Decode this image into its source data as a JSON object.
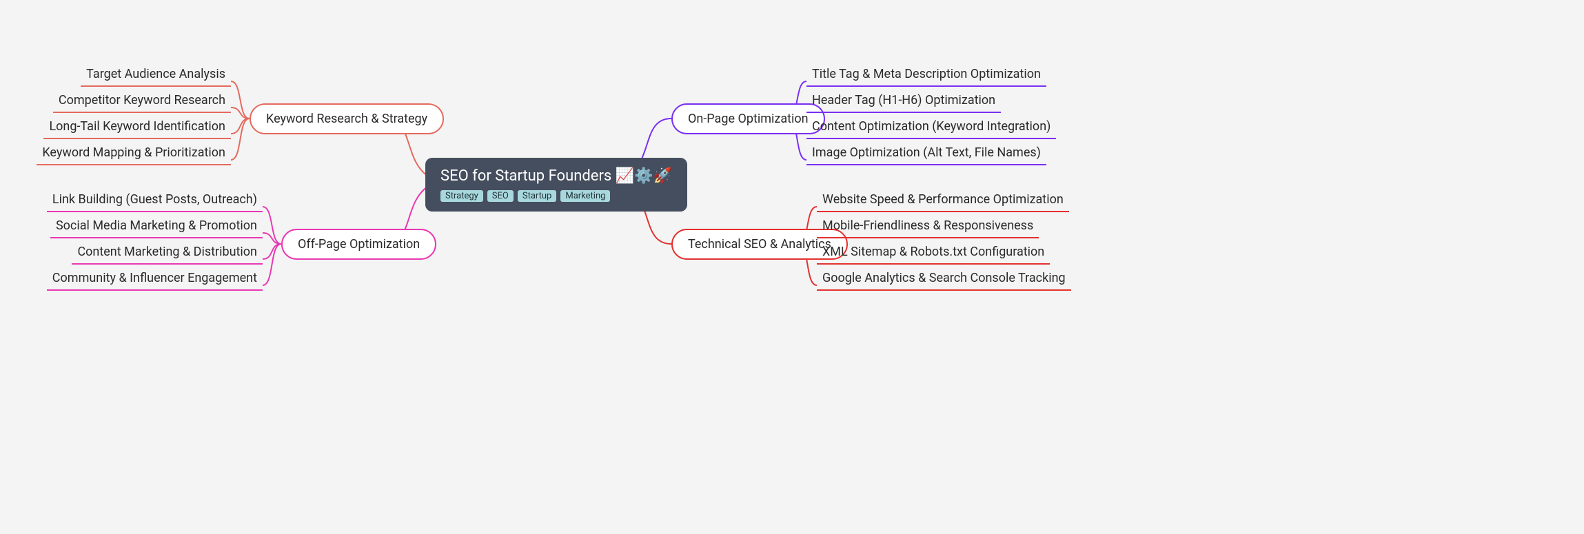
{
  "root": {
    "title": "SEO for Startup Founders 📈⚙️🚀",
    "tags": [
      "Strategy",
      "SEO",
      "Startup",
      "Marketing"
    ]
  },
  "branches": {
    "keyword": {
      "label": "Keyword Research & Strategy",
      "color": "#e46a5e",
      "leaves": [
        "Target Audience Analysis",
        "Competitor Keyword Research",
        "Long-Tail Keyword Identification",
        "Keyword Mapping & Prioritization"
      ]
    },
    "onpage": {
      "label": "On-Page Optimization",
      "color": "#7a2ff2",
      "leaves": [
        "Title Tag & Meta Description Optimization",
        "Header Tag (H1-H6) Optimization",
        "Content Optimization (Keyword Integration)",
        "Image Optimization (Alt Text, File Names)"
      ]
    },
    "offpage": {
      "label": "Off-Page Optimization",
      "color": "#e838b3",
      "leaves": [
        "Link Building (Guest Posts, Outreach)",
        "Social Media Marketing & Promotion",
        "Content Marketing & Distribution",
        "Community & Influencer Engagement"
      ]
    },
    "technical": {
      "label": "Technical SEO & Analytics",
      "color": "#e4312f",
      "leaves": [
        "Website Speed & Performance Optimization",
        "Mobile-Friendliness & Responsiveness",
        "XML Sitemap & Robots.txt Configuration",
        "Google Analytics & Search Console Tracking"
      ]
    }
  }
}
